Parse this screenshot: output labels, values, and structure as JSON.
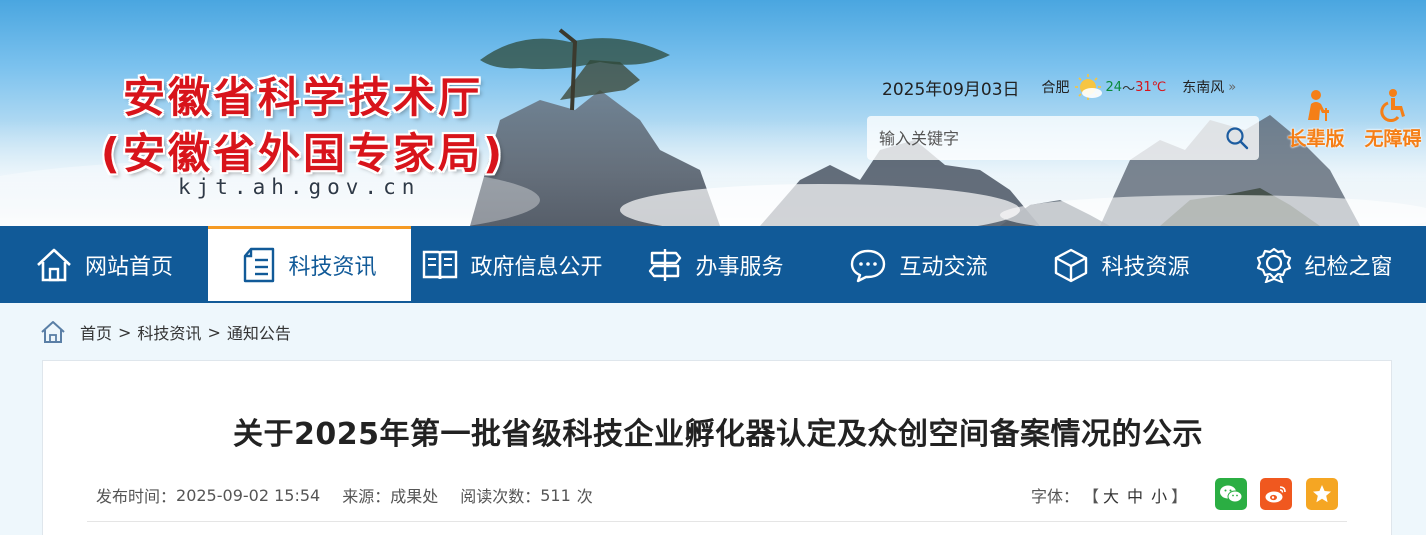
{
  "header": {
    "title_line1": "安徽省科学技术厅",
    "title_line2": "(安徽省外国专家局)",
    "domain": "kjt.ah.gov.cn",
    "date": "2025年09月03日",
    "city": "合肥",
    "temp_low": "24",
    "temp_sep": "～",
    "temp_high": "31℃",
    "wind": "东南风",
    "more": "»",
    "weather_icon": "sunny-icon",
    "search_placeholder": "输入关键字",
    "tools": [
      {
        "label": "长辈版",
        "icon": "elder-mode-icon"
      },
      {
        "label": "无障碍",
        "icon": "accessibility-icon"
      }
    ]
  },
  "nav": {
    "items": [
      {
        "label": "网站首页",
        "icon": "home-icon",
        "active": false
      },
      {
        "label": "科技资讯",
        "icon": "document-icon",
        "active": true
      },
      {
        "label": "政府信息公开",
        "icon": "book-icon",
        "active": false
      },
      {
        "label": "办事服务",
        "icon": "signpost-icon",
        "active": false
      },
      {
        "label": "互动交流",
        "icon": "chat-icon",
        "active": false
      },
      {
        "label": "科技资源",
        "icon": "cube-icon",
        "active": false
      },
      {
        "label": "纪检之窗",
        "icon": "badge-icon",
        "active": false
      }
    ]
  },
  "breadcrumb": {
    "items": [
      "首页",
      "科技资讯",
      "通知公告"
    ],
    "separator": ">"
  },
  "article": {
    "title": "关于2025年第一批省级科技企业孵化器认定及众创空间备案情况的公示",
    "publish_label": "发布时间：",
    "publish_time": "2025-09-02 15:54",
    "source_label": "来源：",
    "source": "成果处",
    "reads_label": "阅读次数：",
    "reads": "511",
    "reads_unit": "次",
    "font_label": "字体：",
    "font_open": "【",
    "font_large": "大",
    "font_medium": "中",
    "font_small": "小",
    "font_close": "】",
    "share_icons": [
      "wechat-icon",
      "weibo-icon",
      "favorite-icon"
    ]
  },
  "colors": {
    "nav_bg": "#115a98",
    "title_red": "#d8141b",
    "accent_orange": "#f57f17",
    "active_tab_border": "#f59a23"
  }
}
